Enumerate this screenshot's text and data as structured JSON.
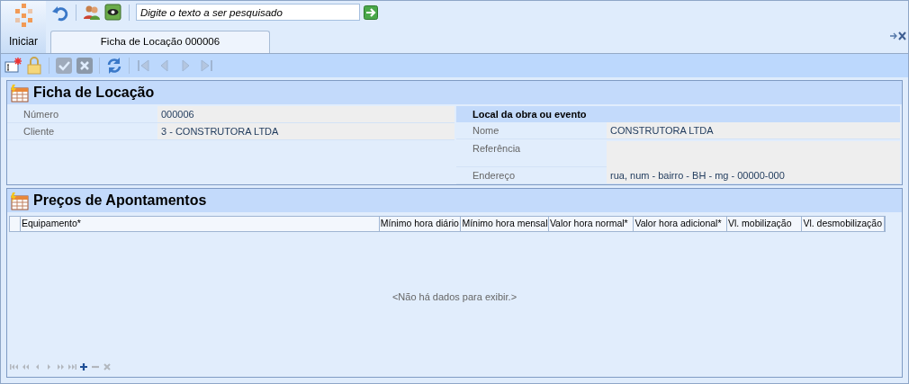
{
  "app": {
    "start_label": "Iniciar"
  },
  "quick_toolbar": [
    {
      "kind": "undo"
    },
    {
      "kind": "users"
    },
    {
      "kind": "eye"
    }
  ],
  "search": {
    "placeholder": "Digite o texto a ser pesquisado"
  },
  "tabs": [
    {
      "label": "Ficha de Locação 000006",
      "selected": true
    }
  ],
  "record_toolbar": [
    {
      "kind": "new",
      "disabled": false
    },
    {
      "kind": "lock",
      "disabled": false
    },
    {
      "kind": "sep"
    },
    {
      "kind": "save",
      "disabled": true
    },
    {
      "kind": "cancel",
      "disabled": true
    },
    {
      "kind": "sep"
    },
    {
      "kind": "refresh",
      "disabled": false
    },
    {
      "kind": "sep"
    },
    {
      "kind": "first",
      "disabled": true
    },
    {
      "kind": "prev",
      "disabled": true
    },
    {
      "kind": "next",
      "disabled": true
    },
    {
      "kind": "last",
      "disabled": true
    }
  ],
  "form": {
    "title": "Ficha de Locação",
    "fields": [
      {
        "label": "Número",
        "value": "000006"
      },
      {
        "label": "Cliente",
        "value": "3 - CONSTRUTORA LTDA"
      }
    ],
    "location": {
      "title": "Local da obra ou evento",
      "fields": [
        {
          "kind": "line",
          "label": "Nome",
          "value": "CONSTRUTORA LTDA"
        },
        {
          "kind": "memo",
          "label": "Referência"
        },
        {
          "kind": "line",
          "label": "Endereço",
          "value": "rua, num - bairro - BH - mg - 00000-000"
        }
      ]
    }
  },
  "grid": {
    "title": "Preços de Apontamentos",
    "columns": [
      "Equipamento*",
      "Mínimo hora diário",
      "Mínimo hora mensal",
      "Valor hora normal*",
      "Valor hora adicional*",
      "Vl. mobilização",
      "Vl. desmobilização"
    ],
    "empty_text": "<Não há dados para exibir.>",
    "navigator": [
      {
        "kind": "first",
        "disabled": true
      },
      {
        "kind": "prev_page",
        "disabled": true
      },
      {
        "kind": "prev",
        "disabled": true
      },
      {
        "kind": "next",
        "disabled": true
      },
      {
        "kind": "next_page",
        "disabled": true
      },
      {
        "kind": "last",
        "disabled": true
      },
      {
        "kind": "add",
        "disabled": false
      },
      {
        "kind": "remove",
        "disabled": true
      },
      {
        "kind": "cancel",
        "disabled": true
      }
    ]
  }
}
